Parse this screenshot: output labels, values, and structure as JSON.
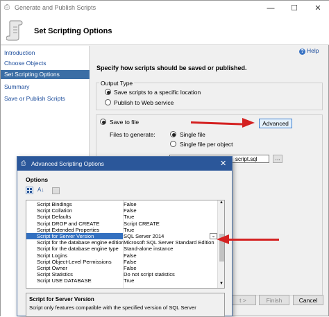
{
  "wizard": {
    "window_title": "Generate and Publish Scripts",
    "header_title": "Set Scripting Options",
    "help_label": "Help",
    "sidebar": [
      {
        "label": "Introduction",
        "selected": false
      },
      {
        "label": "Choose Objects",
        "selected": false
      },
      {
        "label": "Set Scripting Options",
        "selected": true
      },
      {
        "label": "Summary",
        "selected": false
      },
      {
        "label": "Save or Publish Scripts",
        "selected": false
      }
    ],
    "instruction": "Specify how scripts should be saved or published.",
    "output_type": {
      "legend": "Output Type",
      "option_save": "Save scripts to a specific location",
      "option_publish": "Publish to Web service"
    },
    "save_to_file": "Save to file",
    "files_to_generate_label": "Files to generate:",
    "single_file": "Single file",
    "single_file_per_object": "Single file per object",
    "advanced_button": "Advanced",
    "file_path_suffix": "script.sql",
    "browse_button": "...",
    "bottom_buttons": {
      "next": "t >",
      "finish": "Finish",
      "cancel": "Cancel"
    }
  },
  "advanced": {
    "title": "Advanced Scripting Options",
    "options_label": "Options",
    "rows": [
      {
        "name": "Script Bindings",
        "value": "False"
      },
      {
        "name": "Script Collation",
        "value": "False"
      },
      {
        "name": "Script Defaults",
        "value": "True"
      },
      {
        "name": "Script DROP and CREATE",
        "value": "Script CREATE"
      },
      {
        "name": "Script Extended Properties",
        "value": "True"
      },
      {
        "name": "Script for Server Version",
        "value": "SQL Server 2014"
      },
      {
        "name": "Script for the database engine edition",
        "value": "Microsoft SQL Server Standard Edition"
      },
      {
        "name": "Script for the database engine type",
        "value": "Stand-alone instance"
      },
      {
        "name": "Script Logins",
        "value": "False"
      },
      {
        "name": "Script Object-Level Permissions",
        "value": "False"
      },
      {
        "name": "Script Owner",
        "value": "False"
      },
      {
        "name": "Script Statistics",
        "value": "Do not script statistics"
      },
      {
        "name": "Script USE DATABASE",
        "value": "True"
      }
    ],
    "selected_row": "Script for Server Version",
    "description_title": "Script for Server Version",
    "description_text": "Script only features compatible with the specified version of SQL Server"
  },
  "colors": {
    "accent": "#2b579a",
    "selection": "#3370c0",
    "arrow": "#d42121"
  }
}
